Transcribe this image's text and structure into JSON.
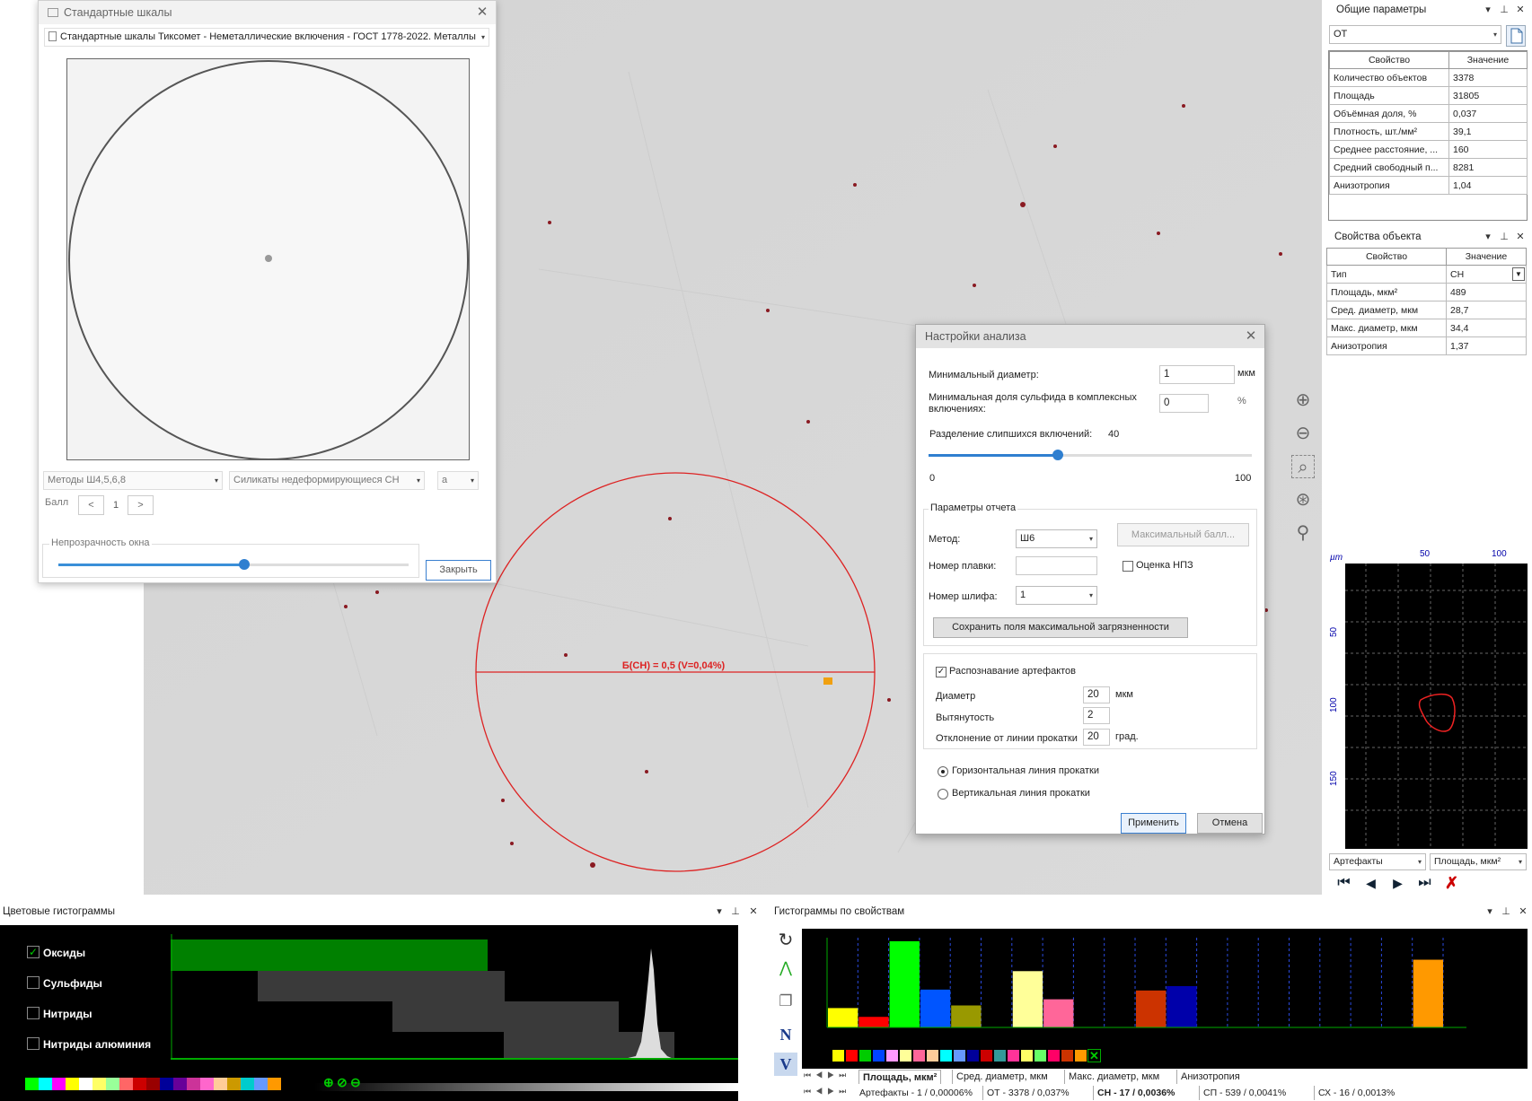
{
  "scales_window": {
    "title": "Стандартные шкалы",
    "scale_select": "Стандартные шкалы Тиксомет  - Неметаллические включения - ГОСТ 1778-2022. Металлы",
    "method_select": "Методы Ш4,5,6,8",
    "type_select": "Силикаты недеформирующиеся СН",
    "sub_select": "а",
    "score_label": "Балл",
    "score_value": "1",
    "prev_label": "<",
    "next_label": ">",
    "opacity_label": "Непрозрачность окна",
    "opacity_level": 0.53,
    "close_label": "Закрыть"
  },
  "overlay": {
    "result_label": "Б(СН) = 0,5 (V=0,04%)"
  },
  "analysis_dialog": {
    "title": "Настройки анализа",
    "min_diameter_label": "Минимальный диаметр:",
    "min_diameter_value": "1",
    "min_diameter_unit": "мкм",
    "min_sulfide_label": "Минимальная доля сульфида в комплексных включениях:",
    "min_sulfide_value": "0",
    "min_sulfide_unit": "%",
    "separation_label": "Разделение слипшихся включений:",
    "separation_value": "40",
    "separation_level": 0.4,
    "slider_min": "0",
    "slider_max": "100",
    "report_group": "Параметры отчета",
    "method_label": "Метод:",
    "method_value": "Ш6",
    "max_score_button": "Максимальный балл...",
    "melt_label": "Номер плавки:",
    "melt_value": "",
    "npz_label": "Оценка НПЗ",
    "section_label": "Номер шлифа:",
    "section_value": "1",
    "save_fields_button": "Сохранить поля максимальной загрязненности",
    "artifacts_label": "Распознавание артефактов",
    "diameter_label": "Диаметр",
    "diameter_value": "20",
    "diameter_unit": "мкм",
    "elongation_label": "Вытянутость",
    "elongation_value": "2",
    "deviation_label": "Отклонение от линии прокатки",
    "deviation_value": "20",
    "deviation_unit": "град.",
    "horizontal_label": "Горизонтальная линия прокатки",
    "vertical_label": "Вертикальная линия прокатки",
    "apply_label": "Применить",
    "cancel_label": "Отмена"
  },
  "general_params": {
    "title": "Общие параметры",
    "combo_value": "ОТ",
    "col_property": "Свойство",
    "col_value": "Значение",
    "rows": [
      {
        "name": "Количество объектов",
        "value": "3378"
      },
      {
        "name": "Площадь",
        "value": "31805"
      },
      {
        "name": "Объёмная доля, %",
        "value": "0,037"
      },
      {
        "name": "Плотность, шт./мм²",
        "value": "39,1"
      },
      {
        "name": "Среднее расстояние, ...",
        "value": "160"
      },
      {
        "name": "Средний свободный п...",
        "value": "8281"
      },
      {
        "name": "Анизотропия",
        "value": "1,04"
      }
    ]
  },
  "object_props": {
    "title": "Свойства объекта",
    "col_property": "Свойство",
    "col_value": "Значение",
    "rows": [
      {
        "name": "Тип",
        "value": "СН"
      },
      {
        "name": "Площадь, мкм²",
        "value": "489"
      },
      {
        "name": "Сред. диаметр, мкм",
        "value": "28,7"
      },
      {
        "name": "Макс. диаметр, мкм",
        "value": "34,4"
      },
      {
        "name": "Анизотропия",
        "value": "1,37"
      }
    ]
  },
  "contour_plot": {
    "unit": "µm",
    "x_ticks": [
      "50",
      "100"
    ],
    "y_ticks": [
      "50",
      "100",
      "150"
    ],
    "combo_left": "Артефакты",
    "combo_right": "Площадь, мкм²"
  },
  "color_histograms": {
    "title": "Цветовые гистограммы",
    "items": [
      {
        "label": "Оксиды",
        "checked": true
      },
      {
        "label": "Сульфиды",
        "checked": false
      },
      {
        "label": "Нитриды",
        "checked": false
      },
      {
        "label": "Нитриды алюминия",
        "checked": false
      }
    ],
    "palette": [
      "#00ff00",
      "#00ffff",
      "#ff00ff",
      "#ffff00",
      "#ffffff",
      "#ffff66",
      "#99ff99",
      "#ff6666",
      "#cc0000",
      "#990000",
      "#000099",
      "#660099",
      "#cc3399",
      "#ff66cc",
      "#ffcc99",
      "#cc9900",
      "#00cccc",
      "#6699ff",
      "#ff9900"
    ],
    "accent_green": "#008000"
  },
  "prop_histograms": {
    "title": "Гистограммы по свойствам",
    "bar_tabs": [
      "Площадь, мкм²",
      "Сред. диаметр, мкм",
      "Макс. диаметр, мкм",
      "Анизотропия"
    ],
    "class_tabs": [
      "Артефакты - 1 / 0,00006%",
      "ОТ - 3378 / 0,037%",
      "СН - 17 / 0,0036%",
      "СП - 539 / 0,0041%",
      "СХ - 16 / 0,0013%"
    ],
    "bars": [
      {
        "value": 0.22,
        "color": "#ffff00"
      },
      {
        "value": 0.12,
        "color": "#ff0000"
      },
      {
        "value": 0.98,
        "color": "#00ff00"
      },
      {
        "value": 0.43,
        "color": "#0055ff"
      },
      {
        "value": 0.25,
        "color": "#999900"
      },
      {
        "value": 0,
        "color": "#000000"
      },
      {
        "value": 0.64,
        "color": "#ffff99"
      },
      {
        "value": 0.32,
        "color": "#ff6699"
      },
      {
        "value": 0,
        "color": "#000000"
      },
      {
        "value": 0,
        "color": "#000000"
      },
      {
        "value": 0.42,
        "color": "#cc3300"
      },
      {
        "value": 0.47,
        "color": "#0000aa"
      },
      {
        "value": 0,
        "color": "#000000"
      },
      {
        "value": 0,
        "color": "#000000"
      },
      {
        "value": 0,
        "color": "#000000"
      },
      {
        "value": 0,
        "color": "#000000"
      },
      {
        "value": 0,
        "color": "#000000"
      },
      {
        "value": 0,
        "color": "#000000"
      },
      {
        "value": 0,
        "color": "#000000"
      },
      {
        "value": 0.77,
        "color": "#ff9900"
      }
    ],
    "swatches": [
      "#ffff00",
      "#ff0000",
      "#00cc00",
      "#0044ff",
      "#ff99ff",
      "#ffff99",
      "#ff6699",
      "#ffcc99",
      "#00ffff",
      "#6699ff",
      "#000099",
      "#cc0000",
      "#339999",
      "#ff3399",
      "#ffff66",
      "#66ff66",
      "#ff0066",
      "#cc3300",
      "#ff9900"
    ]
  }
}
